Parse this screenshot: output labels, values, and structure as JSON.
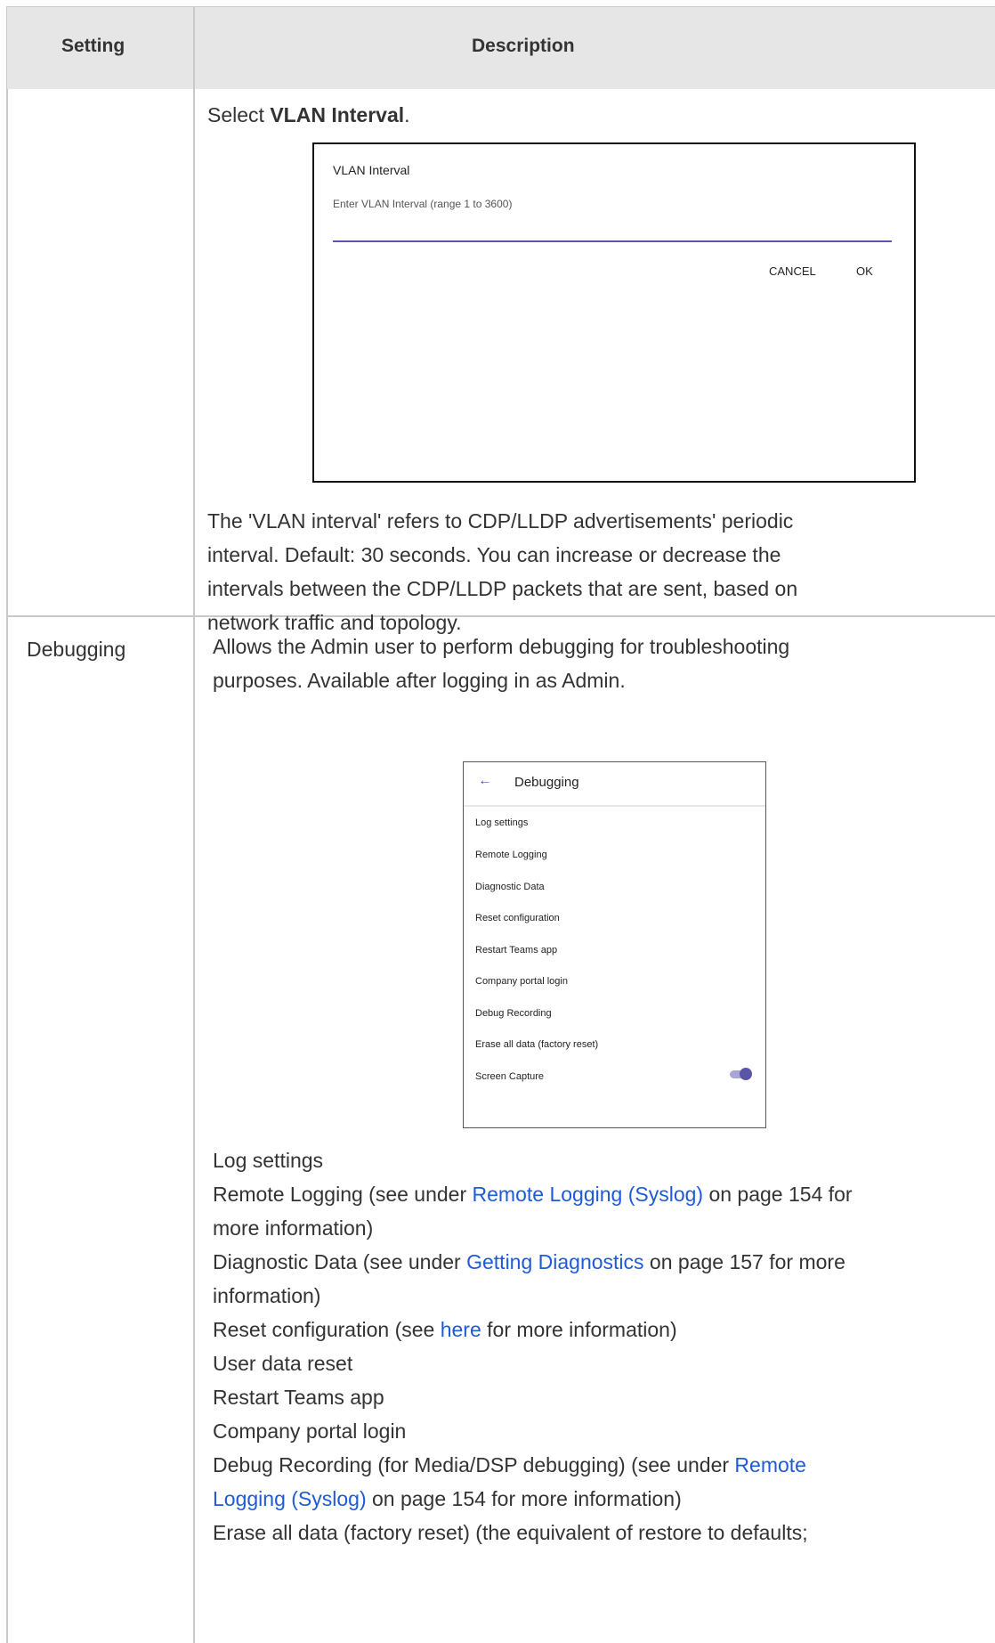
{
  "table": {
    "headers": {
      "setting": "Setting",
      "description": "Description"
    }
  },
  "vlan_row": {
    "instruction_prefix": "Select ",
    "instruction_bold": "VLAN Interval",
    "instruction_suffix": ".",
    "dialog": {
      "title": "VLAN Interval",
      "subtitle": "Enter VLAN Interval  (range 1 to 3600)",
      "cancel_label": "CANCEL",
      "ok_label": "OK"
    },
    "description_lines": [
      "The 'VLAN interval' refers to CDP/LLDP advertisements' periodic",
      "interval. Default: 30 seconds. You can increase or decrease the",
      "intervals between the CDP/LLDP packets that are sent, based on",
      "network traffic and topology."
    ]
  },
  "debugging_row": {
    "setting": "Debugging",
    "intro_lines": [
      "Allows the Admin user to perform debugging for troubleshooting",
      "purposes. Available after logging in as Admin."
    ],
    "screen": {
      "title": "Debugging",
      "back_icon": "arrow-left-icon",
      "items": [
        "Log settings",
        "Remote Logging",
        "Diagnostic Data",
        "Reset configuration",
        "Restart Teams app",
        "Company portal login",
        "Debug Recording",
        "Erase all data (factory reset)",
        "Screen Capture"
      ],
      "screen_capture_enabled": true,
      "accent_color": "#5a55a6"
    },
    "list": {
      "log_settings": "Log settings",
      "remote_logging": {
        "pre": "Remote Logging (see under ",
        "link": "Remote Logging (Syslog)",
        "post": " on page 154 for",
        "cont": "more information)"
      },
      "diagnostic_data": {
        "pre": "Diagnostic Data (see under ",
        "link": "Getting Diagnostics",
        "post": "  on page 157 for more",
        "cont": "information)"
      },
      "reset_configuration": {
        "pre": "Reset configuration  (see ",
        "link": "here",
        "post": " for more information)"
      },
      "user_data_reset": "User data reset",
      "restart_teams_app": "Restart Teams app",
      "company_portal_login": "Company portal login",
      "debug_recording": {
        "pre": "Debug Recording (for Media/DSP debugging) (see under ",
        "link1": "Remote",
        "link2": "Logging (Syslog)",
        "post": " on page 154 for more information)"
      },
      "erase_all_data": "Erase all data (factory reset) (the equivalent of restore to defaults;"
    }
  },
  "colors": {
    "link": "#1f5bd6",
    "header_bg": "#e6e6e6",
    "border": "#c9c9c9"
  }
}
